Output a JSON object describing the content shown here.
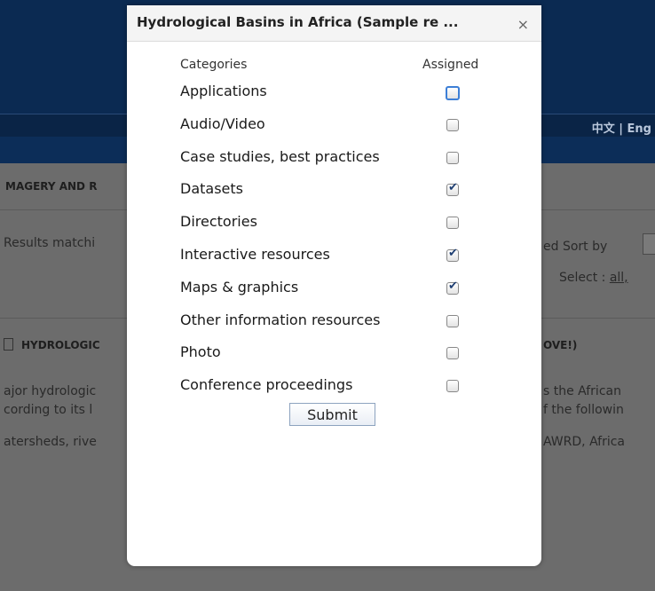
{
  "background": {
    "lang_links": "中文 | Eng",
    "section_heading": "MAGERY AND R",
    "results_text": "Results matchi",
    "sort_text": "ed  Sort by",
    "select_text": "Select : ",
    "select_all": "all,",
    "item_title_left": "HYDROLOGIC",
    "item_title_right": "OVE!)",
    "desc_line1_left": "ajor hydrologic",
    "desc_line1_right": "s the African",
    "desc_line2_left": "cording to its l",
    "desc_line2_right": "f the followin",
    "desc_line3_left": "atersheds, rive",
    "desc_line3_right": "AWRD, Africa"
  },
  "dialog": {
    "title": "Hydrological Basins in Africa (Sample re ...",
    "close_glyph": "×",
    "categories_header": "Categories",
    "assigned_header": "Assigned",
    "categories": [
      {
        "label": "Applications",
        "checked": false,
        "focused": true
      },
      {
        "label": "Audio/Video",
        "checked": false,
        "focused": false
      },
      {
        "label": "Case studies, best practices",
        "checked": false,
        "focused": false
      },
      {
        "label": "Datasets",
        "checked": true,
        "focused": false
      },
      {
        "label": "Directories",
        "checked": false,
        "focused": false
      },
      {
        "label": "Interactive resources",
        "checked": true,
        "focused": false
      },
      {
        "label": "Maps & graphics",
        "checked": true,
        "focused": false
      },
      {
        "label": "Other information resources",
        "checked": false,
        "focused": false
      },
      {
        "label": "Photo",
        "checked": false,
        "focused": false
      },
      {
        "label": "Conference proceedings",
        "checked": false,
        "focused": false
      }
    ],
    "submit_label": "Submit"
  }
}
